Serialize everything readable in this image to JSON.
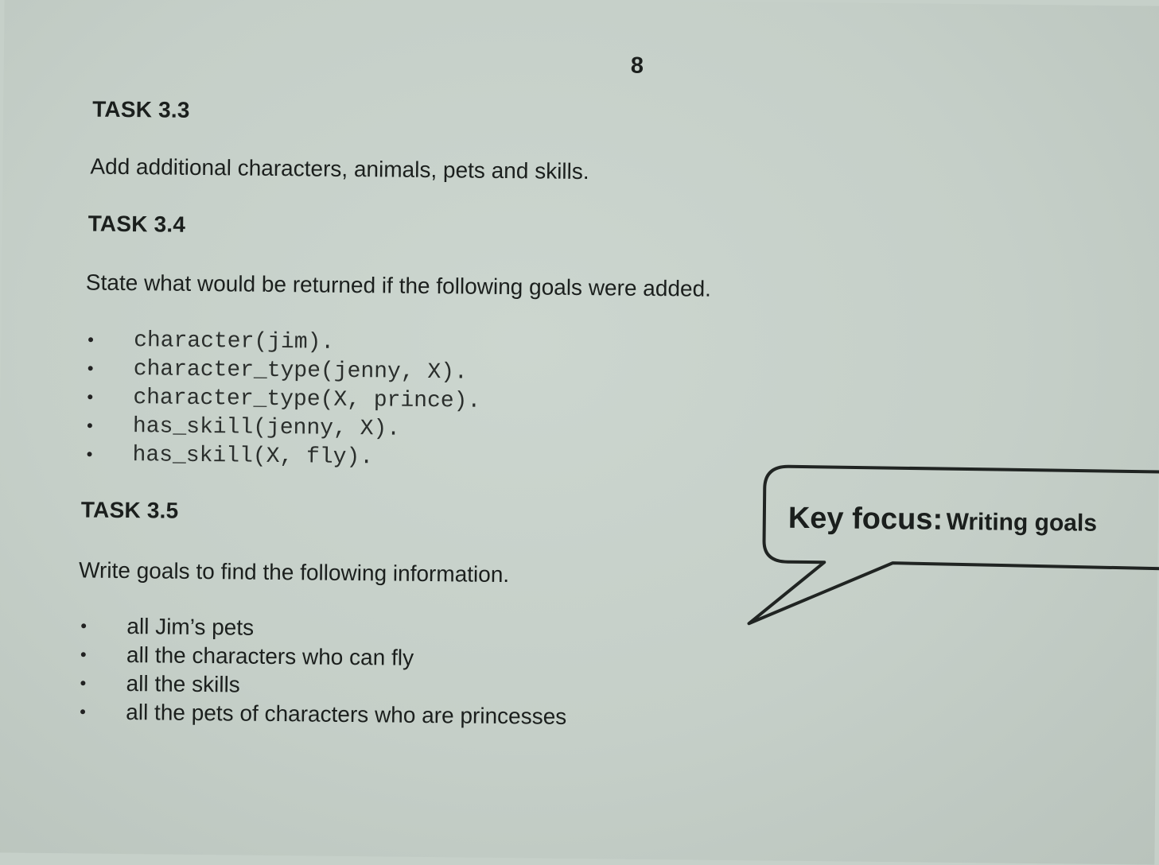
{
  "page": {
    "number": "8"
  },
  "task_3_3": {
    "heading": "TASK 3.3",
    "text": "Add additional characters, animals, pets and skills."
  },
  "task_3_4": {
    "heading": "TASK 3.4",
    "text": "State what would be returned if the following goals were added.",
    "goals": [
      "character(jim).",
      "character_type(jenny, X).",
      "character_type(X, prince).",
      "has_skill(jenny, X).",
      "has_skill(X, fly)."
    ]
  },
  "task_3_5": {
    "heading": "TASK 3.5",
    "text": "Write goals to find the following information.",
    "items": [
      "all Jim’s pets",
      "all the characters who can fly",
      "all the skills",
      "all the pets of characters who are princesses"
    ]
  },
  "callout": {
    "label": "Key focus:",
    "topic": "Writing goals"
  },
  "bullet_glyph": "•",
  "colors": {
    "paper": "#c6d0c9",
    "ink": "#1b1f1d"
  }
}
